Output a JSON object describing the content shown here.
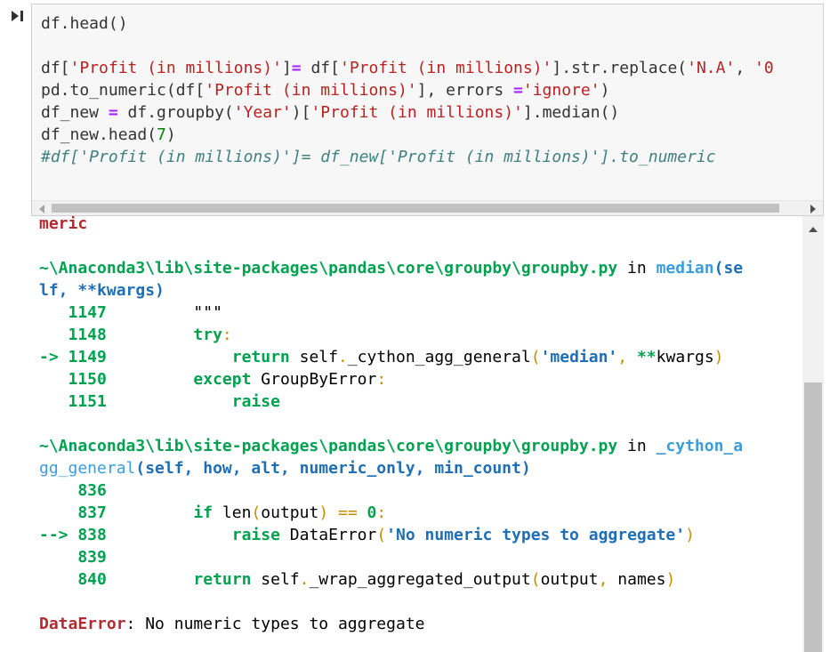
{
  "run_icon": "run-cell-icon",
  "code_cell": {
    "lines": [
      "df.head()",
      "",
      "df['Profit (in millions)']= df['Profit (in millions)'].str.replace('N.A', '0",
      "pd.to_numeric(df['Profit (in millions)'], errors ='ignore')",
      "df_new = df.groupby('Year')['Profit (in millions)'].median()",
      "df_new.head(7)",
      "#df['Profit (in millions)']= df_new['Profit (in millions)'].to_numeric"
    ]
  },
  "output": {
    "lines": [
      "meric",
      "",
      "~\\Anaconda3\\lib\\site-packages\\pandas\\core\\groupby\\groupby.py in median(se",
      "lf, **kwargs)",
      "   1147         \"\"\"",
      "   1148         try:",
      "-> 1149             return self._cython_agg_general('median', **kwargs)",
      "   1150         except GroupByError:",
      "   1151             raise",
      "",
      "~\\Anaconda3\\lib\\site-packages\\pandas\\core\\groupby\\groupby.py in _cython_a",
      "gg_general(self, how, alt, numeric_only, min_count)",
      "    836",
      "    837         if len(output) == 0:",
      "--> 838             raise DataError('No numeric types to aggregate')",
      "    839",
      "    840         return self._wrap_aggregated_output(output, names)",
      "",
      "DataError: No numeric types to aggregate"
    ]
  }
}
